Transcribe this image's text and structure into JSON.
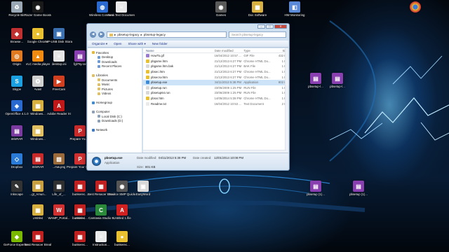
{
  "desktop_icons_left": [
    {
      "label": "Recycle Bin",
      "color": "#9aa7b5",
      "glyph": "♻"
    },
    {
      "label": "Razer Game Booster",
      "color": "#1a1a1a",
      "glyph": "◉"
    },
    {
      "label": "Browse...",
      "color": "#c03030",
      "glyph": "◆"
    },
    {
      "label": "Google Chrome",
      "color": "#e8c030",
      "glyph": "●"
    },
    {
      "label": "HP-USB Disk Storage Fo...",
      "color": "#3a6fb0",
      "glyph": "▣"
    },
    {
      "label": "Origin",
      "color": "#e07a20",
      "glyph": "◎"
    },
    {
      "label": "VLC media player",
      "color": "#f08a10",
      "glyph": "▲"
    },
    {
      "label": "desktop.ini",
      "color": "#e6e6e6",
      "glyph": "≡"
    },
    {
      "label": "fgl79y.rar",
      "color": "#8a3fb0",
      "glyph": "▤"
    },
    {
      "label": "Skype",
      "color": "#1aa0e0",
      "glyph": "S"
    },
    {
      "label": "Avast",
      "color": "#d0d0d0",
      "glyph": "✪"
    },
    {
      "label": "FreeCam",
      "color": "#d04020",
      "glyph": "▶"
    },
    {
      "label": "OpenOffice 4.1.0",
      "color": "#2a6ad0",
      "glyph": "◈"
    },
    {
      "label": "Windows...",
      "color": "#d8b040",
      "glyph": "▦"
    },
    {
      "label": "Adobe Reader XI",
      "color": "#c01818",
      "glyph": "A"
    },
    {
      "label": "WinRAR",
      "color": "#7a3aa0",
      "glyph": "▤"
    },
    {
      "label": "Windows...",
      "color": "#e0c060",
      "glyph": "▦"
    },
    {
      "label": "Prepare Your...",
      "color": "#c82a2a",
      "glyph": "P"
    },
    {
      "label": "Dropbox",
      "color": "#2a7ad8",
      "glyph": "◇"
    },
    {
      "label": "WinRAR",
      "color": "#c82a2a",
      "glyph": "▤"
    },
    {
      "label": "...mw.png",
      "color": "#9a6a3a",
      "glyph": "▧"
    },
    {
      "label": "Prepare Your Computer",
      "color": "#d03030",
      "glyph": "P"
    },
    {
      "label": "Inkscape",
      "color": "#333",
      "glyph": "✎"
    },
    {
      "label": "...gt_Amun...",
      "color": "#c8a040",
      "glyph": "▦"
    },
    {
      "label": "Life_of_...",
      "color": "#303030",
      "glyph": "▦"
    },
    {
      "label": "Untitled",
      "color": "#d8b040",
      "glyph": "▦"
    },
    {
      "label": "WAMP_Portal...",
      "color": "#d03030",
      "glyph": "W"
    },
    {
      "label": "Untitled",
      "color": "#e0c060",
      "glyph": "▦"
    },
    {
      "label": "GeForce Experience",
      "color": "#7ab800",
      "glyph": "◆"
    },
    {
      "label": "Best Renacer Breakdown...",
      "color": "#c02020",
      "glyph": "▦"
    }
  ],
  "desktop_icons_middle": [
    {
      "label": "bunkerec...",
      "color": "#c02020",
      "glyph": "▦"
    },
    {
      "label": "Best Renacer Breakdown...",
      "color": "#c02020",
      "glyph": "▦"
    },
    {
      "label": "Source SMP Quicker",
      "color": "#555",
      "glyph": "◉"
    },
    {
      "label": "EasyWord",
      "color": "#d8d8d8",
      "glyph": "▣"
    },
    {
      "label": "bunkerec...",
      "color": "#c02020",
      "glyph": "▦"
    },
    {
      "label": "Camtasia Studio 8",
      "color": "#2a8a3a",
      "glyph": "C"
    },
    {
      "label": "Untitled 1.file",
      "color": "#d02020",
      "glyph": "A"
    },
    {
      "label": "bunkerec...",
      "color": "#c02020",
      "glyph": "▦"
    },
    {
      "label": "Instruction...",
      "color": "#eaeaea",
      "glyph": "≡"
    },
    {
      "label": "bunkerec...",
      "color": "#e8c030",
      "glyph": "●"
    }
  ],
  "desktop_icons_top": [
    {
      "label": "Wireless Connecti...",
      "color": "#2a6ad0",
      "glyph": "◍"
    },
    {
      "label": "New Text Document.txt",
      "color": "#eaeaea",
      "glyph": "≡"
    },
    {
      "label": "Games",
      "color": "#5a5a5a",
      "glyph": "◉"
    },
    {
      "label": "Doc Software",
      "color": "#d8b040",
      "glyph": "▦"
    },
    {
      "label": "HW Monitoring",
      "color": "#5a8ad8",
      "glyph": "◧"
    }
  ],
  "desktop_icons_right": [
    {
      "label": "pbsetup-l...",
      "color": "#8a3fb0",
      "glyph": "▤"
    },
    {
      "label": "pbsetup-l...",
      "color": "#8a3fb0",
      "glyph": "▤"
    },
    {
      "label": "pbsetup (1)...",
      "color": "#8a3fb0",
      "glyph": "▤"
    },
    {
      "label": "pbsetup (1)...",
      "color": "#8a3fb0",
      "glyph": "▤"
    }
  ],
  "explorer": {
    "address": "pbsetup-legacy",
    "address_sep": "▸",
    "search_placeholder": "Search pbsetup-legacy",
    "toolbar": [
      "Organize ▾",
      "Open",
      "Share with ▾",
      "New folder"
    ],
    "nav": [
      {
        "label": "Favorites",
        "color": "#e8b830",
        "indent": false
      },
      {
        "label": "Desktop",
        "color": "#6a9ad8",
        "indent": true
      },
      {
        "label": "Downloads",
        "color": "#6a9ad8",
        "indent": true
      },
      {
        "label": "Recent Places",
        "color": "#6a9ad8",
        "indent": true
      },
      {
        "label": "",
        "color": "transparent",
        "indent": false
      },
      {
        "label": "Libraries",
        "color": "#e0c060",
        "indent": false
      },
      {
        "label": "Documents",
        "color": "#e0c060",
        "indent": true
      },
      {
        "label": "Music",
        "color": "#e0c060",
        "indent": true
      },
      {
        "label": "Pictures",
        "color": "#e0c060",
        "indent": true
      },
      {
        "label": "Videos",
        "color": "#e0c060",
        "indent": true
      },
      {
        "label": "",
        "color": "transparent",
        "indent": false
      },
      {
        "label": "Homegroup",
        "color": "#3a8ad8",
        "indent": false
      },
      {
        "label": "",
        "color": "transparent",
        "indent": false
      },
      {
        "label": "Computer",
        "color": "#8aa0b8",
        "indent": false
      },
      {
        "label": "Local Disk (C:)",
        "color": "#8aa0b8",
        "indent": true
      },
      {
        "label": "Downloads (D:)",
        "color": "#8aa0b8",
        "indent": true
      },
      {
        "label": "",
        "color": "transparent",
        "indent": false
      },
      {
        "label": "Network",
        "color": "#3a7ac8",
        "indent": false
      }
    ],
    "columns": [
      "Name",
      "Date modified",
      "Type",
      "Size"
    ],
    "files": [
      {
        "name": "HowTo.gif",
        "date": "16/04/2012 10:57 ...",
        "type": "GIF File",
        "size": "432 KB",
        "color": "#9a7ad0"
      },
      {
        "name": "pbgame.htm",
        "date": "21/12/2013 6:27 PM",
        "type": "Chrome HTML Do...",
        "size": "1 KB",
        "color": "#e8c030"
      },
      {
        "name": "pbgame.htm.bak",
        "date": "21/12/2013 6:27 PM",
        "type": "BAK File",
        "size": "1 KB",
        "color": "#d8d8d8"
      },
      {
        "name": "pbsec.htm",
        "date": "21/12/2013 6:27 PM",
        "type": "Chrome HTML Do...",
        "size": "1 KB",
        "color": "#e8c030"
      },
      {
        "name": "pbsecsv.htm",
        "date": "21/12/2013 6:27 PM",
        "type": "Chrome HTML Do...",
        "size": "1 KB",
        "color": "#e8c030"
      },
      {
        "name": "pbsetup.exe",
        "date": "04/11/2013 5:38 PM",
        "type": "Application",
        "size": "802 KB",
        "color": "#3a8ad8"
      },
      {
        "name": "pbsetup.run",
        "date": "23/06/2009 1:25 PM",
        "type": "RUN File",
        "size": "1 KB",
        "color": "#d8d8d8"
      },
      {
        "name": "pbsetup64.run",
        "date": "23/06/2009 1:25 PM",
        "type": "RUN File",
        "size": "1 KB",
        "color": "#d8d8d8"
      },
      {
        "name": "pbsvr.htm",
        "date": "14/05/2014 5:38 PM",
        "type": "Chrome HTML Do...",
        "size": "1 KB",
        "color": "#e8c030"
      },
      {
        "name": "Readme.txt",
        "date": "16/04/2012 10:53 ...",
        "type": "Text Document",
        "size": "2 KB",
        "color": "#eaeaea"
      }
    ],
    "selected_index": 5,
    "details": {
      "name": "pbsetup.exe",
      "modified_label": "Date modified:",
      "modified": "04/11/2013 5:38 PM",
      "created_label": "Date created:",
      "created": "12/01/2014 10:08 PM",
      "type": "Application",
      "size_label": "Size:",
      "size": "801 KB"
    }
  }
}
